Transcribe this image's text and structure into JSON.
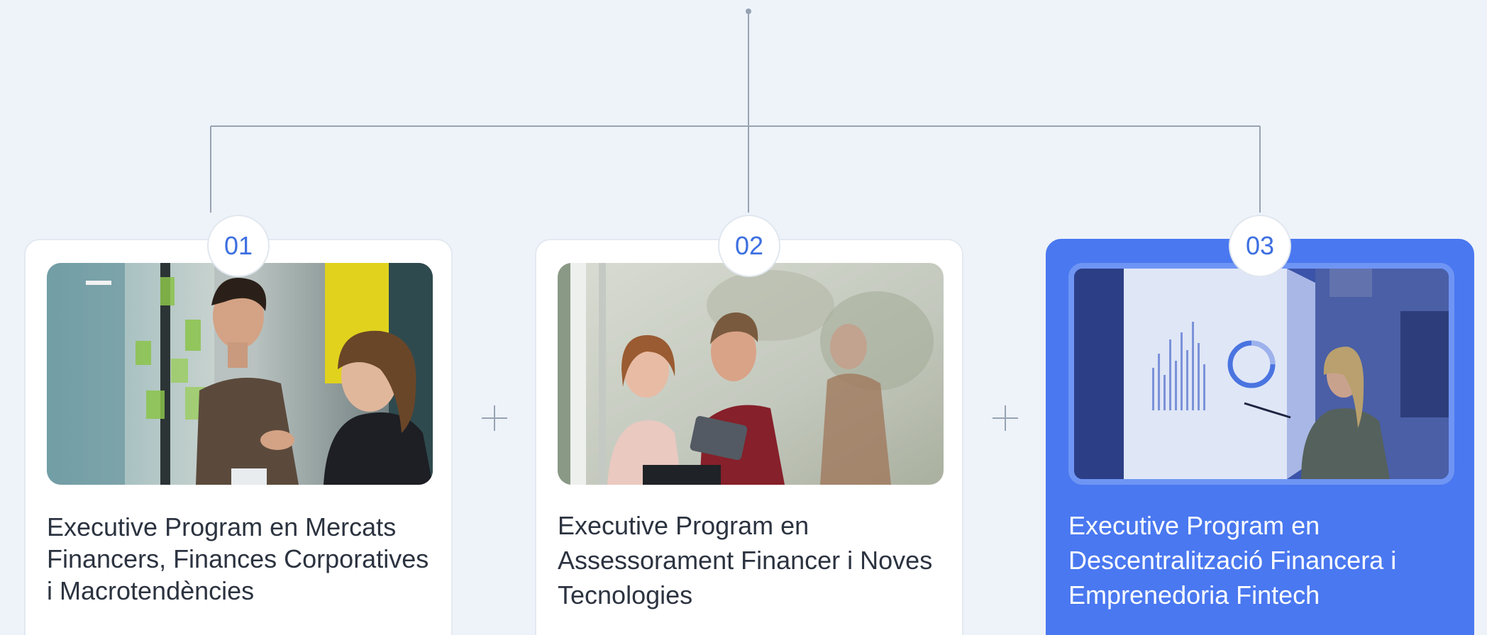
{
  "programs": [
    {
      "number": "01",
      "title": "Executive Program en Mercats Financers, Finances Corporatives i Macrotendències",
      "image": "office-meeting-photo"
    },
    {
      "number": "02",
      "title": "Executive Program en Assessorament Financer i Noves Tecnologies",
      "image": "tablet-colleagues-photo"
    },
    {
      "number": "03",
      "title": "Executive Program en Descentralització Financera i Emprenedoria Fintech",
      "image": "presentation-screen-photo",
      "highlighted": true
    }
  ],
  "separator_icon": "plus-icon",
  "colors": {
    "background": "#eef3f9",
    "accent": "#4a78f0",
    "number_text": "#3d6fe0",
    "connector": "#97a3b3"
  }
}
